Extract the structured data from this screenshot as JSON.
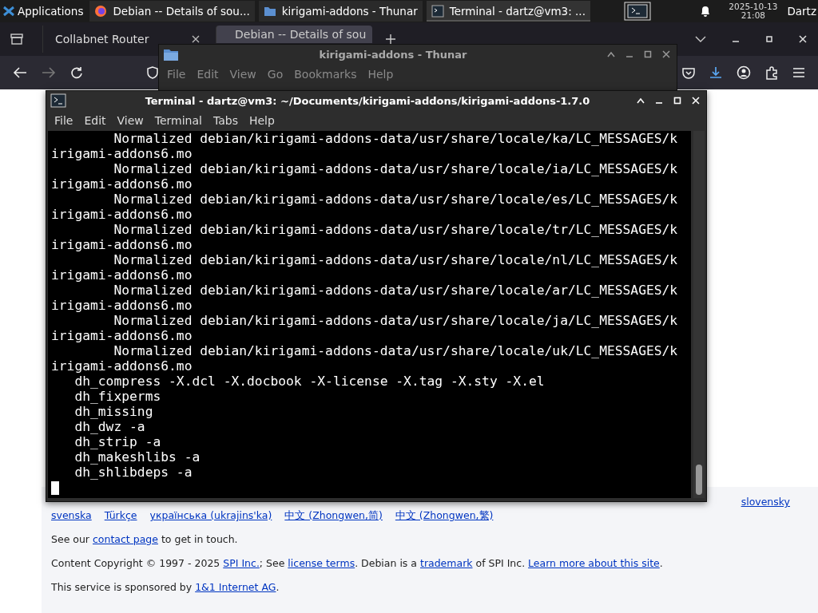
{
  "panel": {
    "applications": "Applications",
    "tasks": [
      {
        "title": "Debian -- Details of sou...",
        "kind": "browser",
        "selected": false
      },
      {
        "title": "kirigami-addons - Thunar",
        "kind": "folder",
        "selected": false
      },
      {
        "title": "Terminal - dartz@vm3: ...",
        "kind": "terminal",
        "selected": true
      }
    ],
    "date": "2025-10-13",
    "time": "21:08",
    "user": "Dartz"
  },
  "browser": {
    "tabs": [
      {
        "title": "Collabnet Router",
        "selected": false
      },
      {
        "title": "Debian -- Details of sou",
        "selected": true
      }
    ],
    "footer": {
      "languages": [
        "slovensky",
        "svenska",
        "Türkçe",
        "українська (ukrajins'ka)",
        "中文 (Zhongwen,简)",
        "中文 (Zhongwen,繁)"
      ],
      "paragraphs": [
        [
          {
            "text": "See our ",
            "link": false
          },
          {
            "text": "contact page",
            "link": true
          },
          {
            "text": " to get in touch.",
            "link": false
          }
        ],
        [
          {
            "text": "Content Copyright © 1997 - 2025 ",
            "link": false
          },
          {
            "text": "SPI Inc.",
            "link": true
          },
          {
            "text": "; See ",
            "link": false
          },
          {
            "text": "license terms",
            "link": true
          },
          {
            "text": ". Debian is a ",
            "link": false
          },
          {
            "text": "trademark",
            "link": true
          },
          {
            "text": " of SPI Inc. ",
            "link": false
          },
          {
            "text": "Learn more about this site",
            "link": true
          },
          {
            "text": ".",
            "link": false
          }
        ],
        [
          {
            "text": "This service is sponsored by ",
            "link": false
          },
          {
            "text": "1&1 Internet AG",
            "link": true
          },
          {
            "text": ".",
            "link": false
          }
        ]
      ]
    }
  },
  "thunar": {
    "title": "kirigami-addons - Thunar",
    "menu": [
      "File",
      "Edit",
      "View",
      "Go",
      "Bookmarks",
      "Help"
    ]
  },
  "terminal": {
    "title": "Terminal - dartz@vm3: ~/Documents/kirigami-addons/kirigami-addons-1.7.0",
    "menu": [
      "File",
      "Edit",
      "View",
      "Terminal",
      "Tabs",
      "Help"
    ],
    "lines": [
      "        Normalized debian/kirigami-addons-data/usr/share/locale/ka/LC_MESSAGES/k",
      "irigami-addons6.mo",
      "        Normalized debian/kirigami-addons-data/usr/share/locale/ia/LC_MESSAGES/k",
      "irigami-addons6.mo",
      "        Normalized debian/kirigami-addons-data/usr/share/locale/es/LC_MESSAGES/k",
      "irigami-addons6.mo",
      "        Normalized debian/kirigami-addons-data/usr/share/locale/tr/LC_MESSAGES/k",
      "irigami-addons6.mo",
      "        Normalized debian/kirigami-addons-data/usr/share/locale/nl/LC_MESSAGES/k",
      "irigami-addons6.mo",
      "        Normalized debian/kirigami-addons-data/usr/share/locale/ar/LC_MESSAGES/k",
      "irigami-addons6.mo",
      "        Normalized debian/kirigami-addons-data/usr/share/locale/ja/LC_MESSAGES/k",
      "irigami-addons6.mo",
      "        Normalized debian/kirigami-addons-data/usr/share/locale/uk/LC_MESSAGES/k",
      "irigami-addons6.mo",
      "   dh_compress -X.dcl -X.docbook -X-license -X.tag -X.sty -X.el",
      "   dh_fixperms",
      "   dh_missing",
      "   dh_dwz -a",
      "   dh_strip -a",
      "   dh_makeshlibs -a",
      "   dh_shlibdeps -a"
    ]
  }
}
